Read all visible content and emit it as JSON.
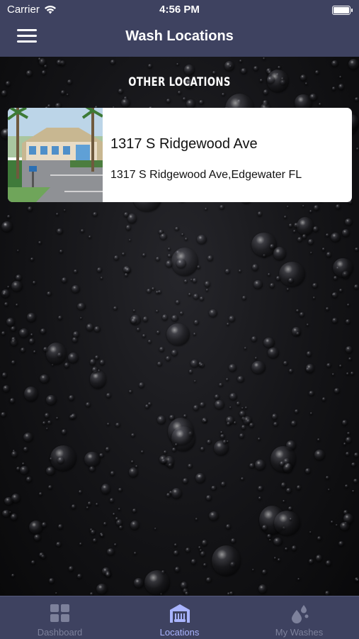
{
  "status_bar": {
    "carrier": "Carrier",
    "time": "4:56 PM"
  },
  "nav": {
    "title": "Wash Locations",
    "menu_icon": "hamburger-menu-icon"
  },
  "section": {
    "label": "OTHER LOCATIONS"
  },
  "locations": [
    {
      "name": "1317 S Ridgewood Ave",
      "address": "1317 S Ridgewood Ave,Edgewater FL"
    }
  ],
  "tabs": [
    {
      "label": "Dashboard",
      "icon": "dashboard-grid-icon",
      "active": false
    },
    {
      "label": "Locations",
      "icon": "car-wash-building-icon",
      "active": true
    },
    {
      "label": "My Washes",
      "icon": "water-drops-icon",
      "active": false
    }
  ],
  "colors": {
    "bar": "#3e4260",
    "active_tab": "#a9b4ff",
    "inactive_tab": "#7d819b"
  }
}
